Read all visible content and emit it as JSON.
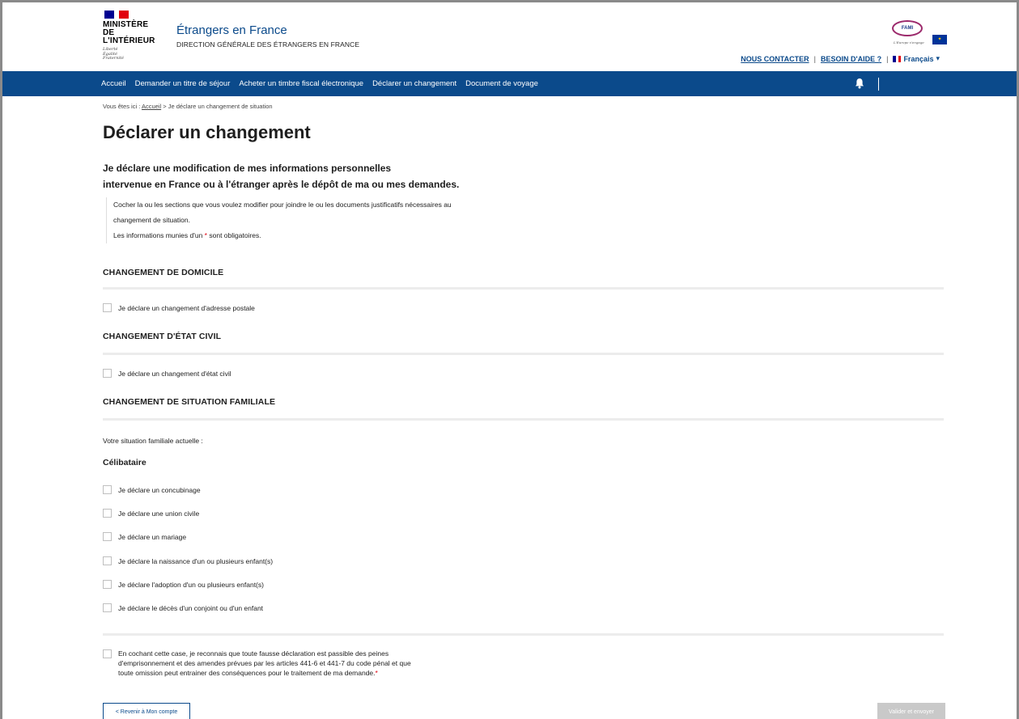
{
  "header": {
    "gov_name_line1": "MINISTÈRE",
    "gov_name_line2": "DE L'INTÉRIEUR",
    "motto_1": "Liberté",
    "motto_2": "Égalité",
    "motto_3": "Fraternité",
    "site_title": "Étrangers en France",
    "site_subtitle": "DIRECTION GÉNÉRALE DES ÉTRANGERS EN FRANCE",
    "fami_logo_text": "FAMI",
    "eu_flag_symbol": "✦",
    "fami_tagline": "L'Europe s'engage",
    "links": {
      "contact": "NOUS CONTACTER",
      "separator": "|",
      "help": "BESOIN D'AIDE ?",
      "language": "Français",
      "language_caret": "▾"
    }
  },
  "nav": {
    "items": [
      "Accueil",
      "Demander un titre de séjour",
      "Acheter un timbre fiscal électronique",
      "Déclarer un changement",
      "Document de voyage"
    ],
    "bell_icon": "bell-icon"
  },
  "breadcrumb": {
    "prefix": "Vous êtes ici :",
    "home": "Accueil",
    "separator": ">",
    "current": "Je déclare un changement de situation"
  },
  "page": {
    "title": "Déclarer un changement",
    "intro_line1": "Je déclare une modification de mes informations personnelles",
    "intro_line2": "intervenue en France ou à l'étranger après le dépôt de ma ou mes demandes.",
    "notice_line1": "Cocher la ou les sections que vous voulez modifier pour joindre le ou les documents justificatifs nécessaires au",
    "notice_line2": "changement de situation.",
    "notice_line3_before": "Les informations munies d'un",
    "notice_star": "*",
    "notice_line3_after": "sont obligatoires."
  },
  "sections": {
    "domicile": {
      "title": "CHANGEMENT DE DOMICILE",
      "option": "Je déclare un changement d'adresse postale"
    },
    "etat_civil": {
      "title": "CHANGEMENT D'ÉTAT CIVIL",
      "option": "Je déclare un changement d'état civil"
    },
    "familiale": {
      "title": "CHANGEMENT DE SITUATION FAMILIALE",
      "current_label": "Votre situation familiale actuelle :",
      "current_value": "Célibataire",
      "options": [
        "Je déclare un concubinage",
        "Je déclare une union civile",
        "Je déclare un mariage",
        "Je déclare la naissance d'un ou plusieurs enfant(s)",
        "Je déclare l'adoption d'un ou plusieurs enfant(s)",
        "Je déclare le décès d'un conjoint ou d'un enfant"
      ]
    }
  },
  "legal": {
    "line1": "En cochant cette case, je reconnais que toute fausse déclaration est passible des peines",
    "line2": "d'emprisonnement et des amendes prévues par les articles 441-6 et 441-7 du code pénal et que",
    "line3": "toute omission peut entrainer des conséquences pour le traitement de ma demande.",
    "star": "*"
  },
  "buttons": {
    "back": "< Revenir à Mon compte",
    "submit": "Valider et envoyer"
  },
  "colors": {
    "primary": "#0b4a8b",
    "required": "#e1000f",
    "disabled": "#c9c9c9"
  }
}
